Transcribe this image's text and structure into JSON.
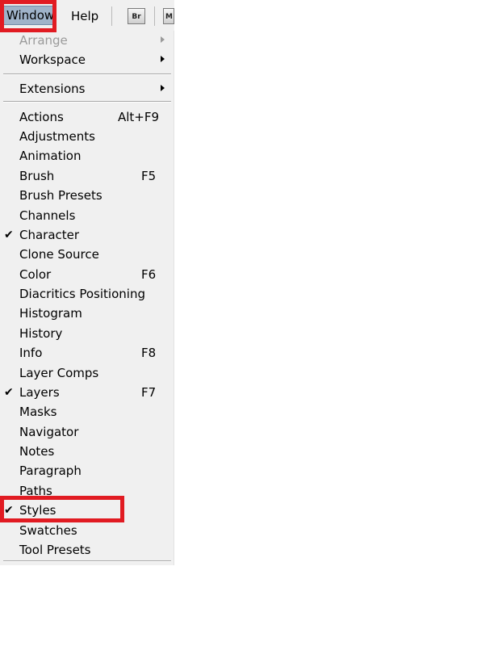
{
  "menubar": {
    "window": "Window",
    "help": "Help",
    "br_button": "Br",
    "mb_button": "M"
  },
  "menu": {
    "arrange": "Arrange",
    "workspace": "Workspace",
    "extensions": "Extensions",
    "actions": "Actions",
    "actions_shortcut": "Alt+F9",
    "adjustments": "Adjustments",
    "animation": "Animation",
    "brush": "Brush",
    "brush_shortcut": "F5",
    "brush_presets": "Brush Presets",
    "channels": "Channels",
    "character": "Character",
    "clone_source": "Clone Source",
    "color": "Color",
    "color_shortcut": "F6",
    "diacritics": "Diacritics Positioning",
    "histogram": "Histogram",
    "history": "History",
    "info": "Info",
    "info_shortcut": "F8",
    "layer_comps": "Layer Comps",
    "layers": "Layers",
    "layers_shortcut": "F7",
    "masks": "Masks",
    "navigator": "Navigator",
    "notes": "Notes",
    "paragraph": "Paragraph",
    "paths": "Paths",
    "styles": "Styles",
    "swatches": "Swatches",
    "tool_presets": "Tool Presets",
    "check_mark": "✔"
  },
  "colors": {
    "highlight_red": "#e11b22",
    "menu_bg": "#f0f0f0",
    "active_menu_bg": "#9fb3c9"
  }
}
